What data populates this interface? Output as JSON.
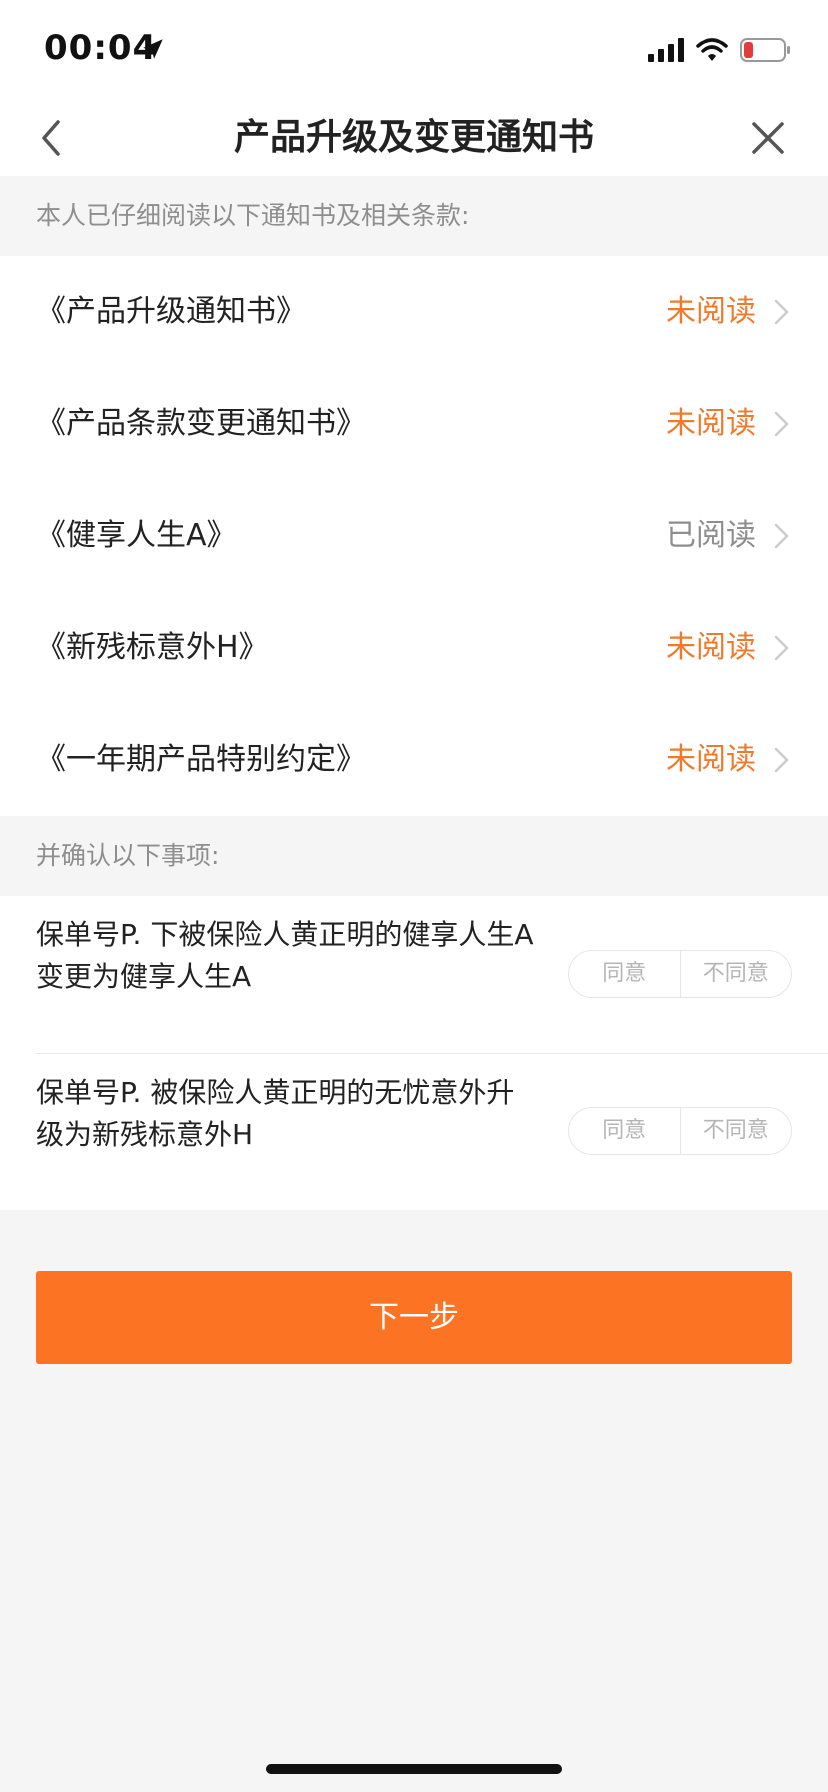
{
  "status_bar": {
    "time": "00:04"
  },
  "nav": {
    "title": "产品升级及变更通知书"
  },
  "documents_section": {
    "header": "本人已仔细阅读以下通知书及相关条款:",
    "items": [
      {
        "title": "《产品升级通知书》",
        "status": "未阅读",
        "read": false
      },
      {
        "title": "《产品条款变更通知书》",
        "status": "未阅读",
        "read": false
      },
      {
        "title": "《健享人生A》",
        "status": "已阅读",
        "read": true
      },
      {
        "title": "《新残标意外H》",
        "status": "未阅读",
        "read": false
      },
      {
        "title": "《一年期产品特别约定》",
        "status": "未阅读",
        "read": false
      }
    ]
  },
  "confirm_section": {
    "header": "并确认以下事项:",
    "items": [
      {
        "text": "保单号P. 下被保险人黄正明的健享人生A变更为健享人生A",
        "agree_label": "同意",
        "disagree_label": "不同意"
      },
      {
        "text": "保单号P. 被保险人黄正明的无忧意外升级为新残标意外H",
        "agree_label": "同意",
        "disagree_label": "不同意"
      }
    ]
  },
  "next_button": {
    "label": "下一步"
  },
  "colors": {
    "accent": "#fb7323",
    "unread": "#f07a2a",
    "muted": "#8e8e8e"
  }
}
